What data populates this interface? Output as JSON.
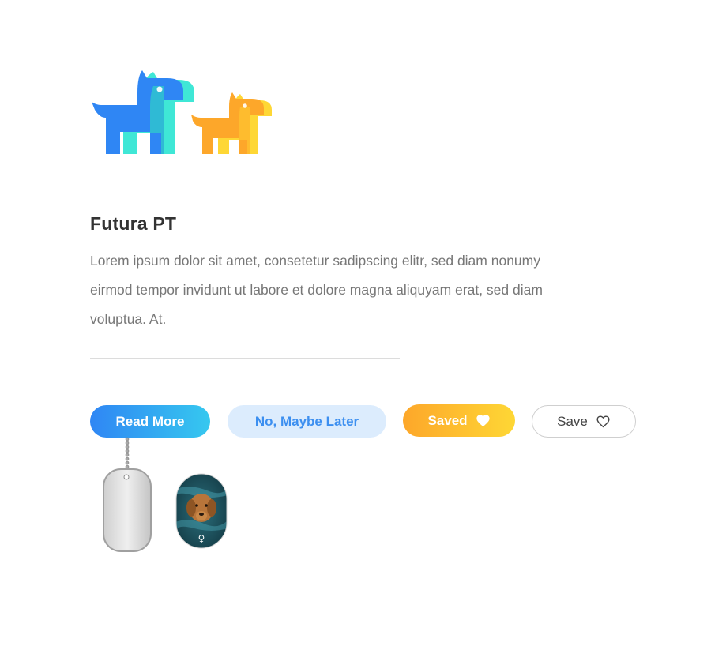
{
  "brand": {
    "logo_icon": "two-dogs-logo-icon",
    "colors": {
      "blue": "#2f86f4",
      "cyan": "#35e6d4",
      "orange": "#fda72a",
      "yellow": "#fed735"
    }
  },
  "article": {
    "heading": "Futura PT",
    "body": "Lorem ipsum dolor sit amet, consetetur sadipscing elitr, sed diam nonumy eirmod tempor invidunt ut labore et dolore magna aliquyam erat, sed diam voluptua. At."
  },
  "buttons": {
    "read_more": "Read More",
    "maybe_later": "No, Maybe Later",
    "saved": "Saved",
    "saved_icon": "heart-filled-icon",
    "save": "Save",
    "save_icon": "heart-outline-icon"
  },
  "tags": {
    "plain_tag_icon": "dog-tag-icon",
    "photo_tag_icon": "dog-photo-tag-icon",
    "gender_symbol": "♀"
  }
}
